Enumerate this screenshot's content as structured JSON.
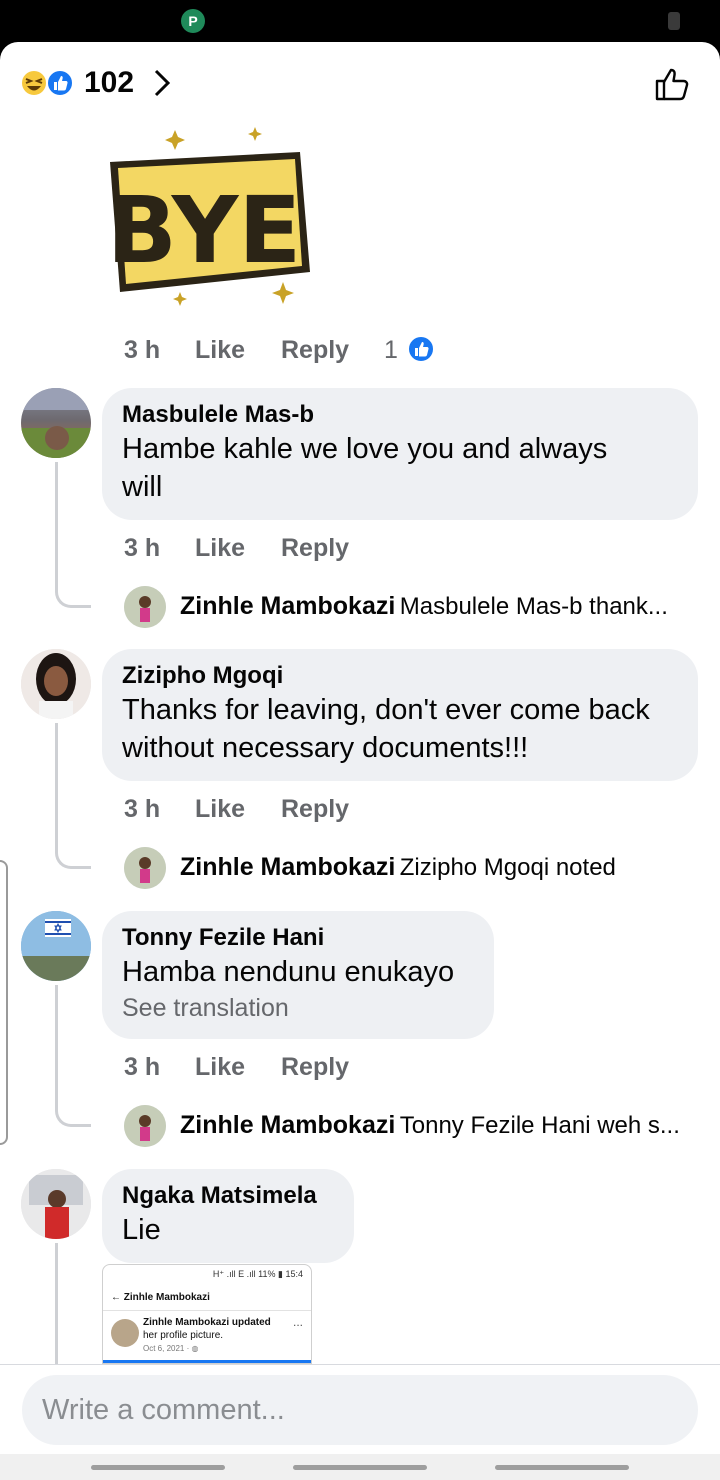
{
  "reactions": {
    "count": "102",
    "icons": [
      "laughing-face-icon",
      "thumbs-up-icon"
    ]
  },
  "sticker": {
    "text": "BYE"
  },
  "comments": [
    {
      "id": "sticker-comment",
      "time": "3 h",
      "like_label": "Like",
      "reply_label": "Reply",
      "reaction_count": "1"
    },
    {
      "id": "masbulele",
      "author": "Masbulele Mas-b",
      "text_line1": "Hambe kahle we love you and always",
      "text_line2": "will",
      "time": "3 h",
      "like_label": "Like",
      "reply_label": "Reply",
      "reply": {
        "author": "Zinhle Mambokazi",
        "text": "Masbulele Mas-b thank..."
      }
    },
    {
      "id": "zizipho",
      "author": "Zizipho Mgoqi",
      "text_line1": "Thanks for leaving, don't ever come back",
      "text_line2": "without necessary documents!!!",
      "time": "3 h",
      "like_label": "Like",
      "reply_label": "Reply",
      "reply": {
        "author": "Zinhle Mambokazi",
        "text": "Zizipho Mgoqi noted"
      }
    },
    {
      "id": "tonny",
      "author": "Tonny Fezile Hani",
      "text_line1": "Hamba nendunu enukayo",
      "see_translation": "See translation",
      "time": "3 h",
      "like_label": "Like",
      "reply_label": "Reply",
      "reply": {
        "author": "Zinhle Mambokazi",
        "text": "Tonny Fezile Hani weh s..."
      }
    },
    {
      "id": "ngaka",
      "author": "Ngaka Matsimela",
      "text_line1": "Lie",
      "attachment": {
        "status": "H⁺ .ıll E .ıll 11% ▮ 15:4",
        "header": "← Zinhle Mambokazi",
        "line1": "Zinhle Mambokazi updated",
        "line2": "her profile picture.",
        "date": "Oct 6, 2021 · ◍",
        "dots": "..."
      }
    }
  ],
  "composer": {
    "placeholder": "Write a comment..."
  },
  "colors": {
    "like_blue": "#1877f2",
    "bubble_gray": "#eef0f3",
    "meta_gray": "#65676b"
  }
}
